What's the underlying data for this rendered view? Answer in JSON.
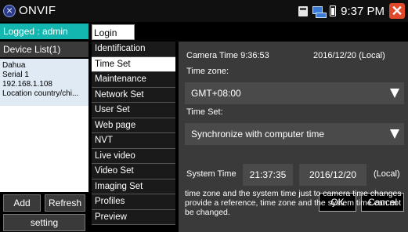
{
  "titlebar": {
    "title": "ONVIF",
    "time": "9:37 PM",
    "icons": [
      "app-icon",
      "sd-card-icon",
      "network-icon",
      "battery-icon",
      "close-icon"
    ]
  },
  "session": {
    "logged_label": "Logged : admin",
    "logout_label": "Login Out"
  },
  "device_list": {
    "header": "Device List(1)",
    "items": [
      {
        "name": "Dahua",
        "serial": "Serial 1",
        "ip": "192.168.1.108",
        "location": "Location country/chi..."
      }
    ],
    "add_label": "Add",
    "refresh_label": "Refresh",
    "setting_label": "setting"
  },
  "menu": {
    "items": [
      {
        "label": "Identification",
        "active": false
      },
      {
        "label": "Time Set",
        "active": true
      },
      {
        "label": "Maintenance",
        "active": false
      },
      {
        "label": "Network Set",
        "active": false
      },
      {
        "label": "User Set",
        "active": false
      },
      {
        "label": "Web page",
        "active": false
      },
      {
        "label": "NVT",
        "active": false
      },
      {
        "label": "Live video",
        "active": false
      },
      {
        "label": "Video Set",
        "active": false
      },
      {
        "label": "Imaging Set",
        "active": false
      },
      {
        "label": "Profiles",
        "active": false
      },
      {
        "label": "Preview",
        "active": false
      }
    ]
  },
  "time_set": {
    "camera_time": "Camera Time 9:36:53",
    "camera_date": "2016/12/20 (Local)",
    "timezone_label": "Time zone:",
    "timezone_value": "GMT+08:00",
    "timeset_label": "Time Set:",
    "timeset_value": "Synchronize with computer time",
    "system_time_label": "System Time",
    "system_time": "21:37:35",
    "system_date": "2016/12/20",
    "local_label": "(Local)",
    "ok_label": "OK",
    "cancel_label": "Cancel",
    "note": "time zone and the system time just to camera time changes provide a reference, time zone and the system time can not be changed."
  },
  "colors": {
    "accent": "#13b7b0",
    "close": "#e04a2b",
    "panel": "#3a3a3a"
  }
}
